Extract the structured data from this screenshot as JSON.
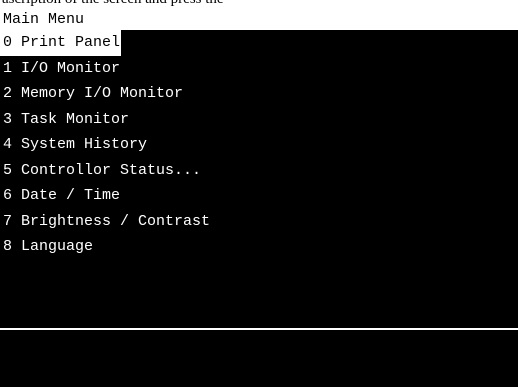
{
  "top_strip_text": "ascription of the screen and press the",
  "header": {
    "title": "Main Menu"
  },
  "menu": {
    "selected_index": 0,
    "items": [
      {
        "label": "0 Print Panel"
      },
      {
        "label": "1 I/O Monitor"
      },
      {
        "label": "2 Memory I/O Monitor"
      },
      {
        "label": "3 Task Monitor"
      },
      {
        "label": "4 System History"
      },
      {
        "label": "5 Controllor Status..."
      },
      {
        "label": "6 Date / Time"
      },
      {
        "label": "7 Brightness / Contrast"
      },
      {
        "label": "8 Language"
      }
    ]
  },
  "colors": {
    "screen_background": "#000000",
    "text": "#ffffff",
    "highlight_background": "#ffffff",
    "highlight_text": "#000000"
  }
}
